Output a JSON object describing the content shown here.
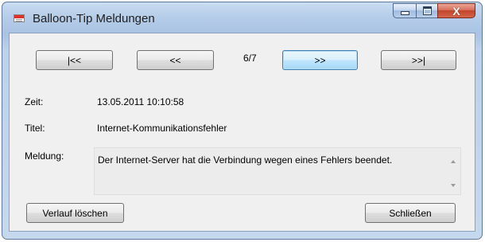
{
  "window": {
    "title": "Balloon-Tip Meldungen",
    "close_glyph": "X"
  },
  "nav": {
    "first": "|<<",
    "prev": "<<",
    "counter": "6/7",
    "next": ">>",
    "last": ">>|"
  },
  "fields": {
    "time_label": "Zeit:",
    "time_value": "13.05.2011 10:10:58",
    "title_label": "Titel:",
    "title_value": "Internet-Kommunikationsfehler",
    "message_label": "Meldung:",
    "message_value": "Der Internet-Server hat die Verbindung wegen eines Fehlers beendet."
  },
  "buttons": {
    "clear_history": "Verlauf löschen",
    "close": "Schließen"
  },
  "icons": {
    "app": "app-window-icon",
    "minimize": "minimize-icon",
    "maximize": "maximize-icon",
    "close": "close-icon",
    "scroll_up": "scroll-up-arrow-icon",
    "scroll_down": "scroll-down-arrow-icon"
  },
  "colors": {
    "close_button": "#c0432b",
    "focus_button_border": "#3c7fb1"
  }
}
